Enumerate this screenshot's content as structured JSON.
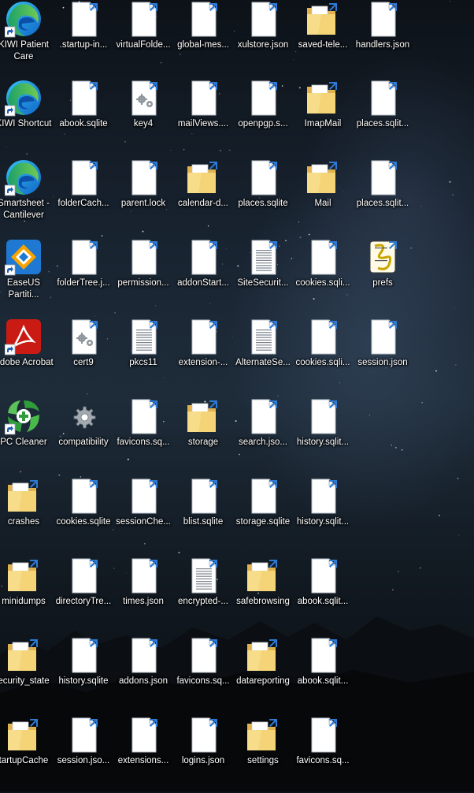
{
  "desktop": {
    "columns": [
      [
        {
          "label": "KIWI Patient Care",
          "icon": "edge-icon"
        },
        {
          "label": "KIWI Shortcut",
          "icon": "edge-icon"
        },
        {
          "label": "Smartsheet - Cantilever",
          "icon": "edge-icon"
        },
        {
          "label": "EaseUS Partiti...",
          "icon": "easeus-icon"
        },
        {
          "label": "Adobe Acrobat",
          "icon": "acrobat-icon"
        },
        {
          "label": "PC Cleaner",
          "icon": "pc-cleaner-icon"
        },
        {
          "label": "crashes",
          "icon": "folder-icon"
        },
        {
          "label": "minidumps",
          "icon": "folder-icon"
        },
        {
          "label": "ecurity_state",
          "icon": "folder-icon"
        },
        {
          "label": "tartupCache",
          "icon": "folder-icon"
        }
      ],
      [
        {
          "label": ".startup-in...",
          "icon": "file-icon"
        },
        {
          "label": "abook.sqlite",
          "icon": "file-icon"
        },
        {
          "label": "folderCach...",
          "icon": "file-icon"
        },
        {
          "label": "folderTree.j...",
          "icon": "file-icon"
        },
        {
          "label": "cert9",
          "icon": "settings-file-icon"
        },
        {
          "label": "compatibility",
          "icon": "gear-icon"
        },
        {
          "label": "cookies.sqlite",
          "icon": "file-icon"
        },
        {
          "label": "directoryTre...",
          "icon": "file-icon"
        },
        {
          "label": "history.sqlite",
          "icon": "file-icon"
        },
        {
          "label": "session.jso...",
          "icon": "file-icon"
        }
      ],
      [
        {
          "label": "virtualFolde...",
          "icon": "file-icon"
        },
        {
          "label": "key4",
          "icon": "settings-file-icon"
        },
        {
          "label": "parent.lock",
          "icon": "file-icon"
        },
        {
          "label": "permission...",
          "icon": "file-icon"
        },
        {
          "label": "pkcs11",
          "icon": "text-file-icon"
        },
        {
          "label": "favicons.sq...",
          "icon": "file-icon"
        },
        {
          "label": "sessionChe...",
          "icon": "file-icon"
        },
        {
          "label": "times.json",
          "icon": "file-icon"
        },
        {
          "label": "addons.json",
          "icon": "file-icon"
        },
        {
          "label": "extensions...",
          "icon": "file-icon"
        }
      ],
      [
        {
          "label": "global-mes...",
          "icon": "file-icon"
        },
        {
          "label": "mailViews....",
          "icon": "file-icon"
        },
        {
          "label": "calendar-d...",
          "icon": "folder-icon"
        },
        {
          "label": "addonStart...",
          "icon": "file-icon"
        },
        {
          "label": "extension-...",
          "icon": "file-icon"
        },
        {
          "label": "storage",
          "icon": "folder-icon"
        },
        {
          "label": "blist.sqlite",
          "icon": "file-icon"
        },
        {
          "label": "encrypted-...",
          "icon": "text-file-icon"
        },
        {
          "label": "favicons.sq...",
          "icon": "file-icon"
        },
        {
          "label": "logins.json",
          "icon": "file-icon"
        }
      ],
      [
        {
          "label": "xulstore.json",
          "icon": "file-icon"
        },
        {
          "label": "openpgp.s...",
          "icon": "file-icon"
        },
        {
          "label": "places.sqlite",
          "icon": "file-icon"
        },
        {
          "label": "SiteSecurit...",
          "icon": "text-file-icon"
        },
        {
          "label": "AlternateSe...",
          "icon": "text-file-icon"
        },
        {
          "label": "search.jso...",
          "icon": "file-icon"
        },
        {
          "label": "storage.sqlite",
          "icon": "file-icon"
        },
        {
          "label": "safebrowsing",
          "icon": "folder-icon"
        },
        {
          "label": "datareporting",
          "icon": "folder-icon"
        },
        {
          "label": "settings",
          "icon": "folder-icon"
        }
      ],
      [
        {
          "label": "saved-tele...",
          "icon": "folder-icon"
        },
        {
          "label": "ImapMail",
          "icon": "folder-icon"
        },
        {
          "label": "Mail",
          "icon": "folder-icon"
        },
        {
          "label": "cookies.sqli...",
          "icon": "file-icon"
        },
        {
          "label": "cookies.sqli...",
          "icon": "file-icon"
        },
        {
          "label": "history.sqlit...",
          "icon": "file-icon"
        },
        {
          "label": "history.sqlit...",
          "icon": "file-icon"
        },
        {
          "label": "abook.sqlit...",
          "icon": "file-icon"
        },
        {
          "label": "abook.sqlit...",
          "icon": "file-icon"
        },
        {
          "label": "favicons.sq...",
          "icon": "file-icon"
        }
      ],
      [
        {
          "label": "handlers.json",
          "icon": "file-icon"
        },
        {
          "label": "places.sqlit...",
          "icon": "file-icon"
        },
        {
          "label": "places.sqlit...",
          "icon": "file-icon"
        },
        {
          "label": "prefs",
          "icon": "script-icon"
        },
        {
          "label": "session.json",
          "icon": "file-icon"
        }
      ]
    ]
  }
}
